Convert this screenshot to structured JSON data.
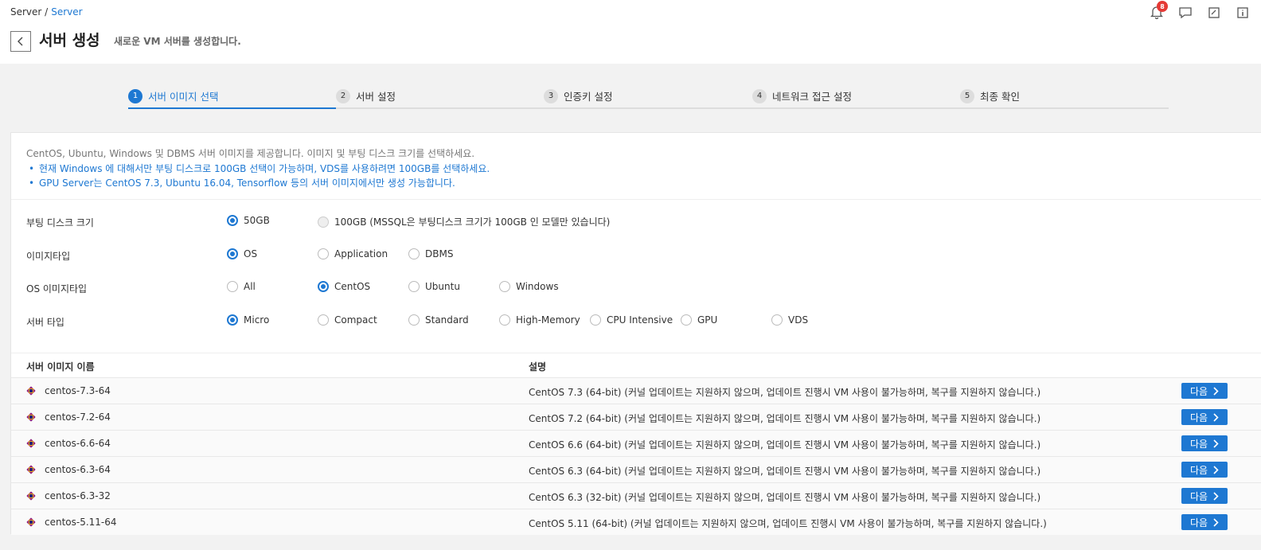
{
  "breadcrumb": {
    "root": "Server /",
    "current": "Server"
  },
  "header": {
    "title": "서버 생성",
    "subtitle": "새로운 VM 서버를 생성합니다."
  },
  "notifications": {
    "count": "8"
  },
  "steps": [
    {
      "num": "1",
      "label": "서버 이미지 선택"
    },
    {
      "num": "2",
      "label": "서버 설정"
    },
    {
      "num": "3",
      "label": "인증키 설정"
    },
    {
      "num": "4",
      "label": "네트워크 접근 설정"
    },
    {
      "num": "5",
      "label": "최종 확인"
    }
  ],
  "notice": {
    "main": "CentOS, Ubuntu, Windows 및 DBMS 서버 이미지를 제공합니다. 이미지 및 부팅 디스크 크기를 선택하세요.",
    "bullets": [
      "현재 Windows 에 대해서만 부팅 디스크로 100GB 선택이 가능하며, VDS를 사용하려면 100GB를 선택하세요.",
      "GPU Server는 CentOS 7.3, Ubuntu 16.04, Tensorflow 등의 서버 이미지에서만 생성 가능합니다."
    ]
  },
  "options": {
    "boot_disk": {
      "label": "부팅 디스크 크기",
      "choices": [
        "50GB",
        "100GB (MSSQL은 부팅디스크 크기가 100GB 인 모델만 있습니다)"
      ],
      "selected": "50GB"
    },
    "image_type": {
      "label": "이미지타입",
      "choices": [
        "OS",
        "Application",
        "DBMS"
      ],
      "selected": "OS"
    },
    "os_image_type": {
      "label": "OS 이미지타입",
      "choices": [
        "All",
        "CentOS",
        "Ubuntu",
        "Windows"
      ],
      "selected": "CentOS"
    },
    "server_type": {
      "label": "서버 타입",
      "choices": [
        "Micro",
        "Compact",
        "Standard",
        "High-Memory",
        "CPU Intensive",
        "GPU",
        "VDS"
      ],
      "selected": "Micro"
    }
  },
  "table": {
    "headers": {
      "name": "서버 이미지 이름",
      "desc": "설명"
    },
    "next_label": "다음",
    "rows": [
      {
        "name": "centos-7.3-64",
        "desc": "CentOS 7.3 (64-bit) (커널 업데이트는 지원하지 않으며, 업데이트 진행시 VM 사용이 불가능하며, 복구를 지원하지 않습니다.)"
      },
      {
        "name": "centos-7.2-64",
        "desc": "CentOS 7.2 (64-bit) (커널 업데이트는 지원하지 않으며, 업데이트 진행시 VM 사용이 불가능하며, 복구를 지원하지 않습니다.)"
      },
      {
        "name": "centos-6.6-64",
        "desc": "CentOS 6.6 (64-bit) (커널 업데이트는 지원하지 않으며, 업데이트 진행시 VM 사용이 불가능하며, 복구를 지원하지 않습니다.)"
      },
      {
        "name": "centos-6.3-64",
        "desc": "CentOS 6.3 (64-bit) (커널 업데이트는 지원하지 않으며, 업데이트 진행시 VM 사용이 불가능하며, 복구를 지원하지 않습니다.)"
      },
      {
        "name": "centos-6.3-32",
        "desc": "CentOS 6.3 (32-bit) (커널 업데이트는 지원하지 않으며, 업데이트 진행시 VM 사용이 불가능하며, 복구를 지원하지 않습니다.)"
      },
      {
        "name": "centos-5.11-64",
        "desc": "CentOS 5.11 (64-bit) (커널 업데이트는 지원하지 않으며, 업데이트 진행시 VM 사용이 불가능하며, 복구를 지원하지 않습니다.)"
      }
    ]
  },
  "colors": {
    "accent": "#1e78d2",
    "badge": "#e53935"
  },
  "icons": {
    "back": "chevron-left-icon",
    "bell": "bell-icon",
    "chat": "chat-icon",
    "memo": "memo-icon",
    "info": "info-icon",
    "row": "centos-logo-icon",
    "next": "chevron-right-icon"
  }
}
